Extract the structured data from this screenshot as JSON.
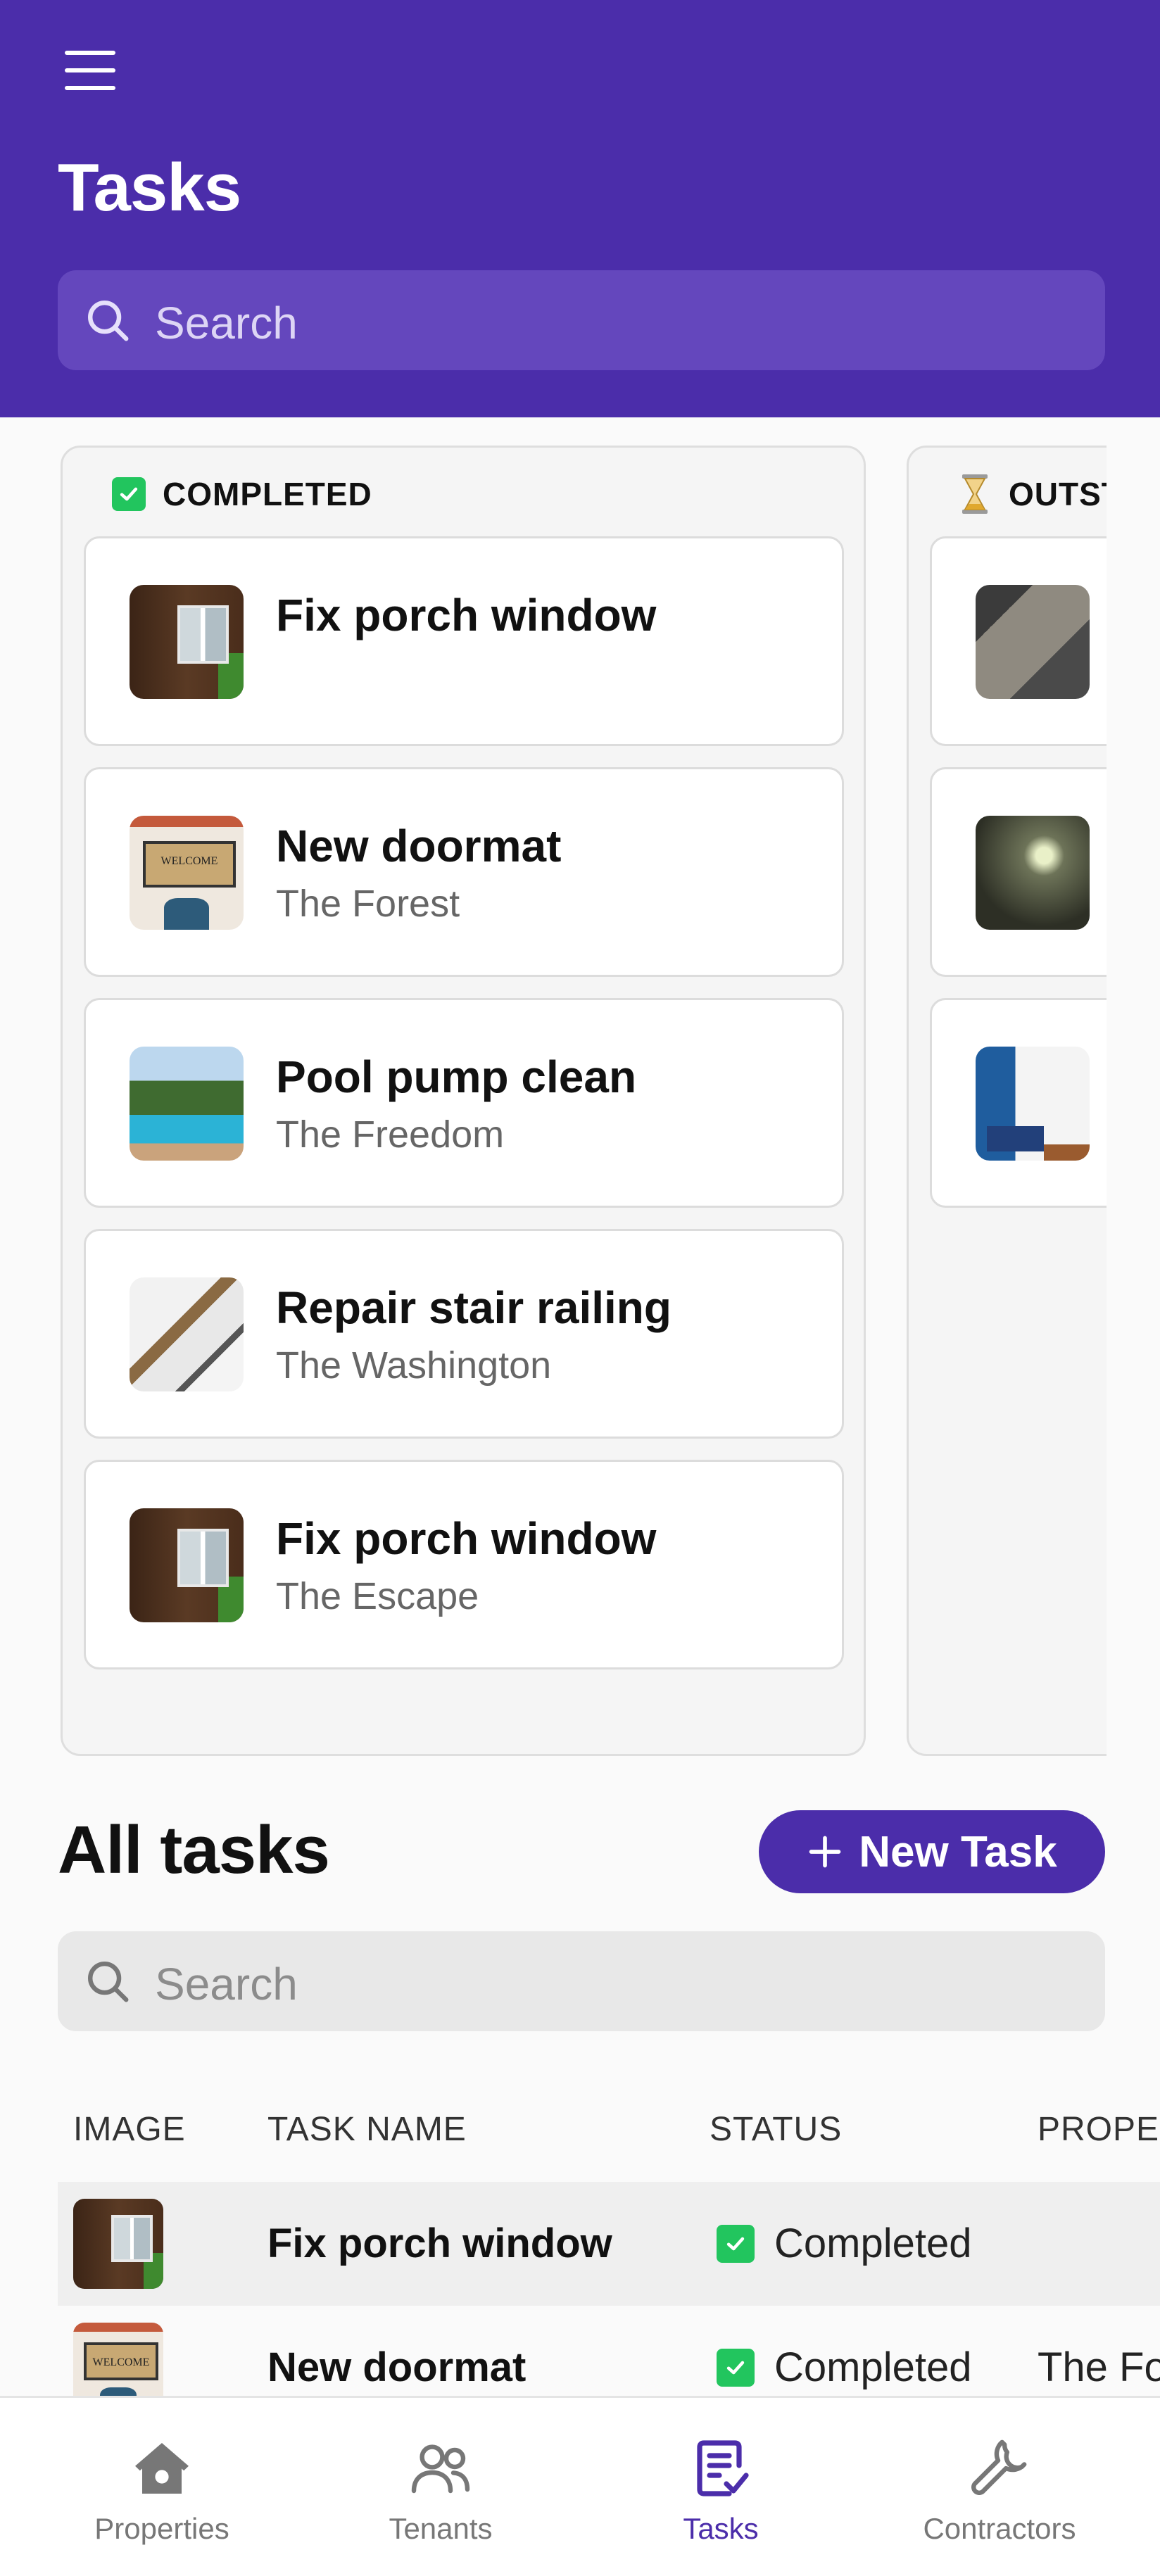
{
  "header": {
    "title": "Tasks",
    "search_placeholder": "Search"
  },
  "board": {
    "columns": [
      {
        "label": "COMPLETED",
        "icon": "check-icon",
        "cards": [
          {
            "title": "Fix porch window",
            "subtitle": "",
            "image": "porch-window-photo"
          },
          {
            "title": "New doormat",
            "subtitle": "The Forest",
            "image": "doormat-photo"
          },
          {
            "title": "Pool pump clean",
            "subtitle": "The Freedom",
            "image": "pool-photo"
          },
          {
            "title": "Repair stair railing",
            "subtitle": "The Washington",
            "image": "stair-railing-photo"
          },
          {
            "title": "Fix porch window",
            "subtitle": "The Escape",
            "image": "porch-window-photo"
          }
        ]
      },
      {
        "label": "OUTSTANDING",
        "icon": "hourglass-icon",
        "cards": [
          {
            "title": "",
            "subtitle": "",
            "image": "rug-photo"
          },
          {
            "title": "",
            "subtitle": "",
            "image": "tunnel-photo"
          },
          {
            "title": "",
            "subtitle": "",
            "image": "living-room-photo"
          }
        ]
      }
    ]
  },
  "all_tasks": {
    "title": "All tasks",
    "new_task_label": "New Task",
    "search_placeholder": "Search",
    "columns": [
      "IMAGE",
      "TASK NAME",
      "STATUS",
      "PROPERTY"
    ],
    "rows": [
      {
        "name": "Fix porch window",
        "status": "Completed",
        "property": "",
        "image": "porch-window-photo"
      },
      {
        "name": "New doormat",
        "status": "Completed",
        "property": "The Forest",
        "image": "doormat-photo"
      }
    ]
  },
  "nav": {
    "items": [
      {
        "label": "Properties",
        "icon": "house-icon"
      },
      {
        "label": "Tenants",
        "icon": "people-icon"
      },
      {
        "label": "Tasks",
        "icon": "tasks-icon",
        "active": true
      },
      {
        "label": "Contractors",
        "icon": "wrench-icon"
      }
    ]
  },
  "colors": {
    "brand": "#4b2daa",
    "header_search_bg": "#6447bd",
    "status_completed": "#22c55e"
  }
}
